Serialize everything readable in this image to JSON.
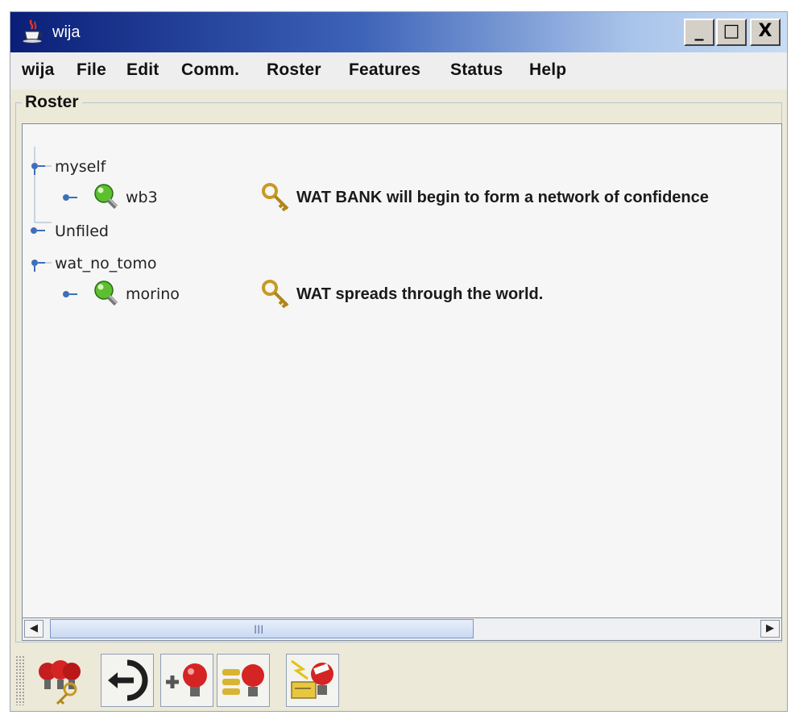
{
  "window": {
    "title": "wija",
    "controls": {
      "minimize": "_",
      "maximize": "□",
      "close": "X"
    }
  },
  "menu": [
    "wija",
    "File",
    "Edit",
    "Comm.",
    "Roster",
    "Features",
    "Status",
    "Help"
  ],
  "roster_panel": {
    "title": "Roster",
    "groups": [
      {
        "name": "myself",
        "contacts": [
          {
            "name": "wb3",
            "status": "WAT BANK will begin to form a network of confidence"
          }
        ]
      },
      {
        "name": "Unfiled",
        "contacts": []
      },
      {
        "name": "wat_no_tomo",
        "contacts": [
          {
            "name": "morino",
            "status": "WAT spreads through the world."
          }
        ]
      }
    ]
  },
  "scrollbar": {
    "grip": "III",
    "left_arrow": "◀",
    "right_arrow": "▶"
  },
  "toolbar_icons": [
    "contacts-key-icon",
    "back-arrow-icon",
    "add-contact-icon",
    "roster-list-icon",
    "message-card-icon"
  ]
}
